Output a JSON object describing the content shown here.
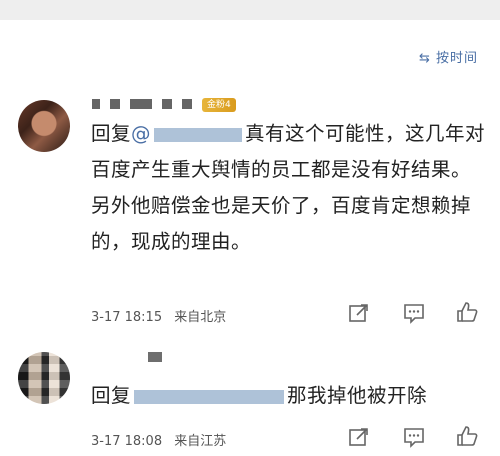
{
  "header": {
    "sort_label": "按时间"
  },
  "comments": [
    {
      "badge": "金粉4",
      "text_prefix": "回复",
      "mention_at": "@",
      "text_after_mention": "真有这个可能性，这几年对百度产生重大舆情的员工都是没有好结果。另外他赔偿金也是天价了，百度肯定想赖掉的，现成的理由。",
      "time": "3-17 18:15",
      "location": "来自北京"
    },
    {
      "text_prefix": "回复",
      "text_after_mention": "那我掉他被开除",
      "time": "3-17 18:08",
      "location": "来自江苏"
    }
  ],
  "icons": {
    "share": "share-icon",
    "comment": "comment-icon",
    "like": "thumbs-up-icon"
  }
}
